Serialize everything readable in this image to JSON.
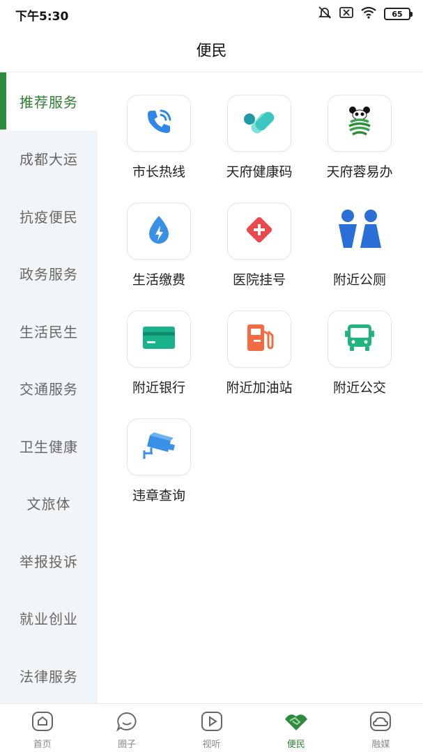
{
  "status_bar": {
    "time": "下午5:30",
    "battery": "65",
    "icons": [
      "mute-icon",
      "no-sim-icon",
      "wifi-icon",
      "battery-icon"
    ]
  },
  "header": {
    "title": "便民"
  },
  "sidebar": {
    "items": [
      {
        "label": "推荐服务",
        "active": true
      },
      {
        "label": "成都大运",
        "active": false
      },
      {
        "label": "抗疫便民",
        "active": false
      },
      {
        "label": "政务服务",
        "active": false
      },
      {
        "label": "生活民生",
        "active": false
      },
      {
        "label": "交通服务",
        "active": false
      },
      {
        "label": "卫生健康",
        "active": false
      },
      {
        "label": "文旅体",
        "active": false
      },
      {
        "label": "举报投诉",
        "active": false
      },
      {
        "label": "就业创业",
        "active": false
      },
      {
        "label": "法律服务",
        "active": false
      }
    ]
  },
  "services": [
    {
      "label": "市长热线",
      "icon": "phone-icon"
    },
    {
      "label": "天府健康码",
      "icon": "health-code-icon"
    },
    {
      "label": "天府蓉易办",
      "icon": "panda-icon"
    },
    {
      "label": "生活缴费",
      "icon": "water-drop-icon"
    },
    {
      "label": "医院挂号",
      "icon": "medical-cross-icon"
    },
    {
      "label": "附近公厕",
      "icon": "toilet-icon"
    },
    {
      "label": "附近银行",
      "icon": "bank-card-icon"
    },
    {
      "label": "附近加油站",
      "icon": "fuel-icon"
    },
    {
      "label": "附近公交",
      "icon": "bus-icon"
    },
    {
      "label": "违章查询",
      "icon": "camera-icon"
    }
  ],
  "bottom_nav": [
    {
      "label": "首页",
      "icon": "home-icon",
      "active": false
    },
    {
      "label": "圈子",
      "icon": "chat-icon",
      "active": false
    },
    {
      "label": "视听",
      "icon": "play-icon",
      "active": false
    },
    {
      "label": "便民",
      "icon": "handshake-icon",
      "active": true
    },
    {
      "label": "融媒",
      "icon": "cloud-icon",
      "active": false
    }
  ],
  "colors": {
    "accent": "#2e7d32",
    "sidebar_bg": "#f2f5f8",
    "phone_blue": "#2f88e8",
    "health_teal": "#3cc6c0",
    "water_blue": "#3a8fe6",
    "medical_red": "#ea4a4f",
    "toilet_blue": "#2a6fd6",
    "bank_green": "#19b28a",
    "fuel_orange": "#f26b42",
    "bus_green": "#1fb57c"
  }
}
